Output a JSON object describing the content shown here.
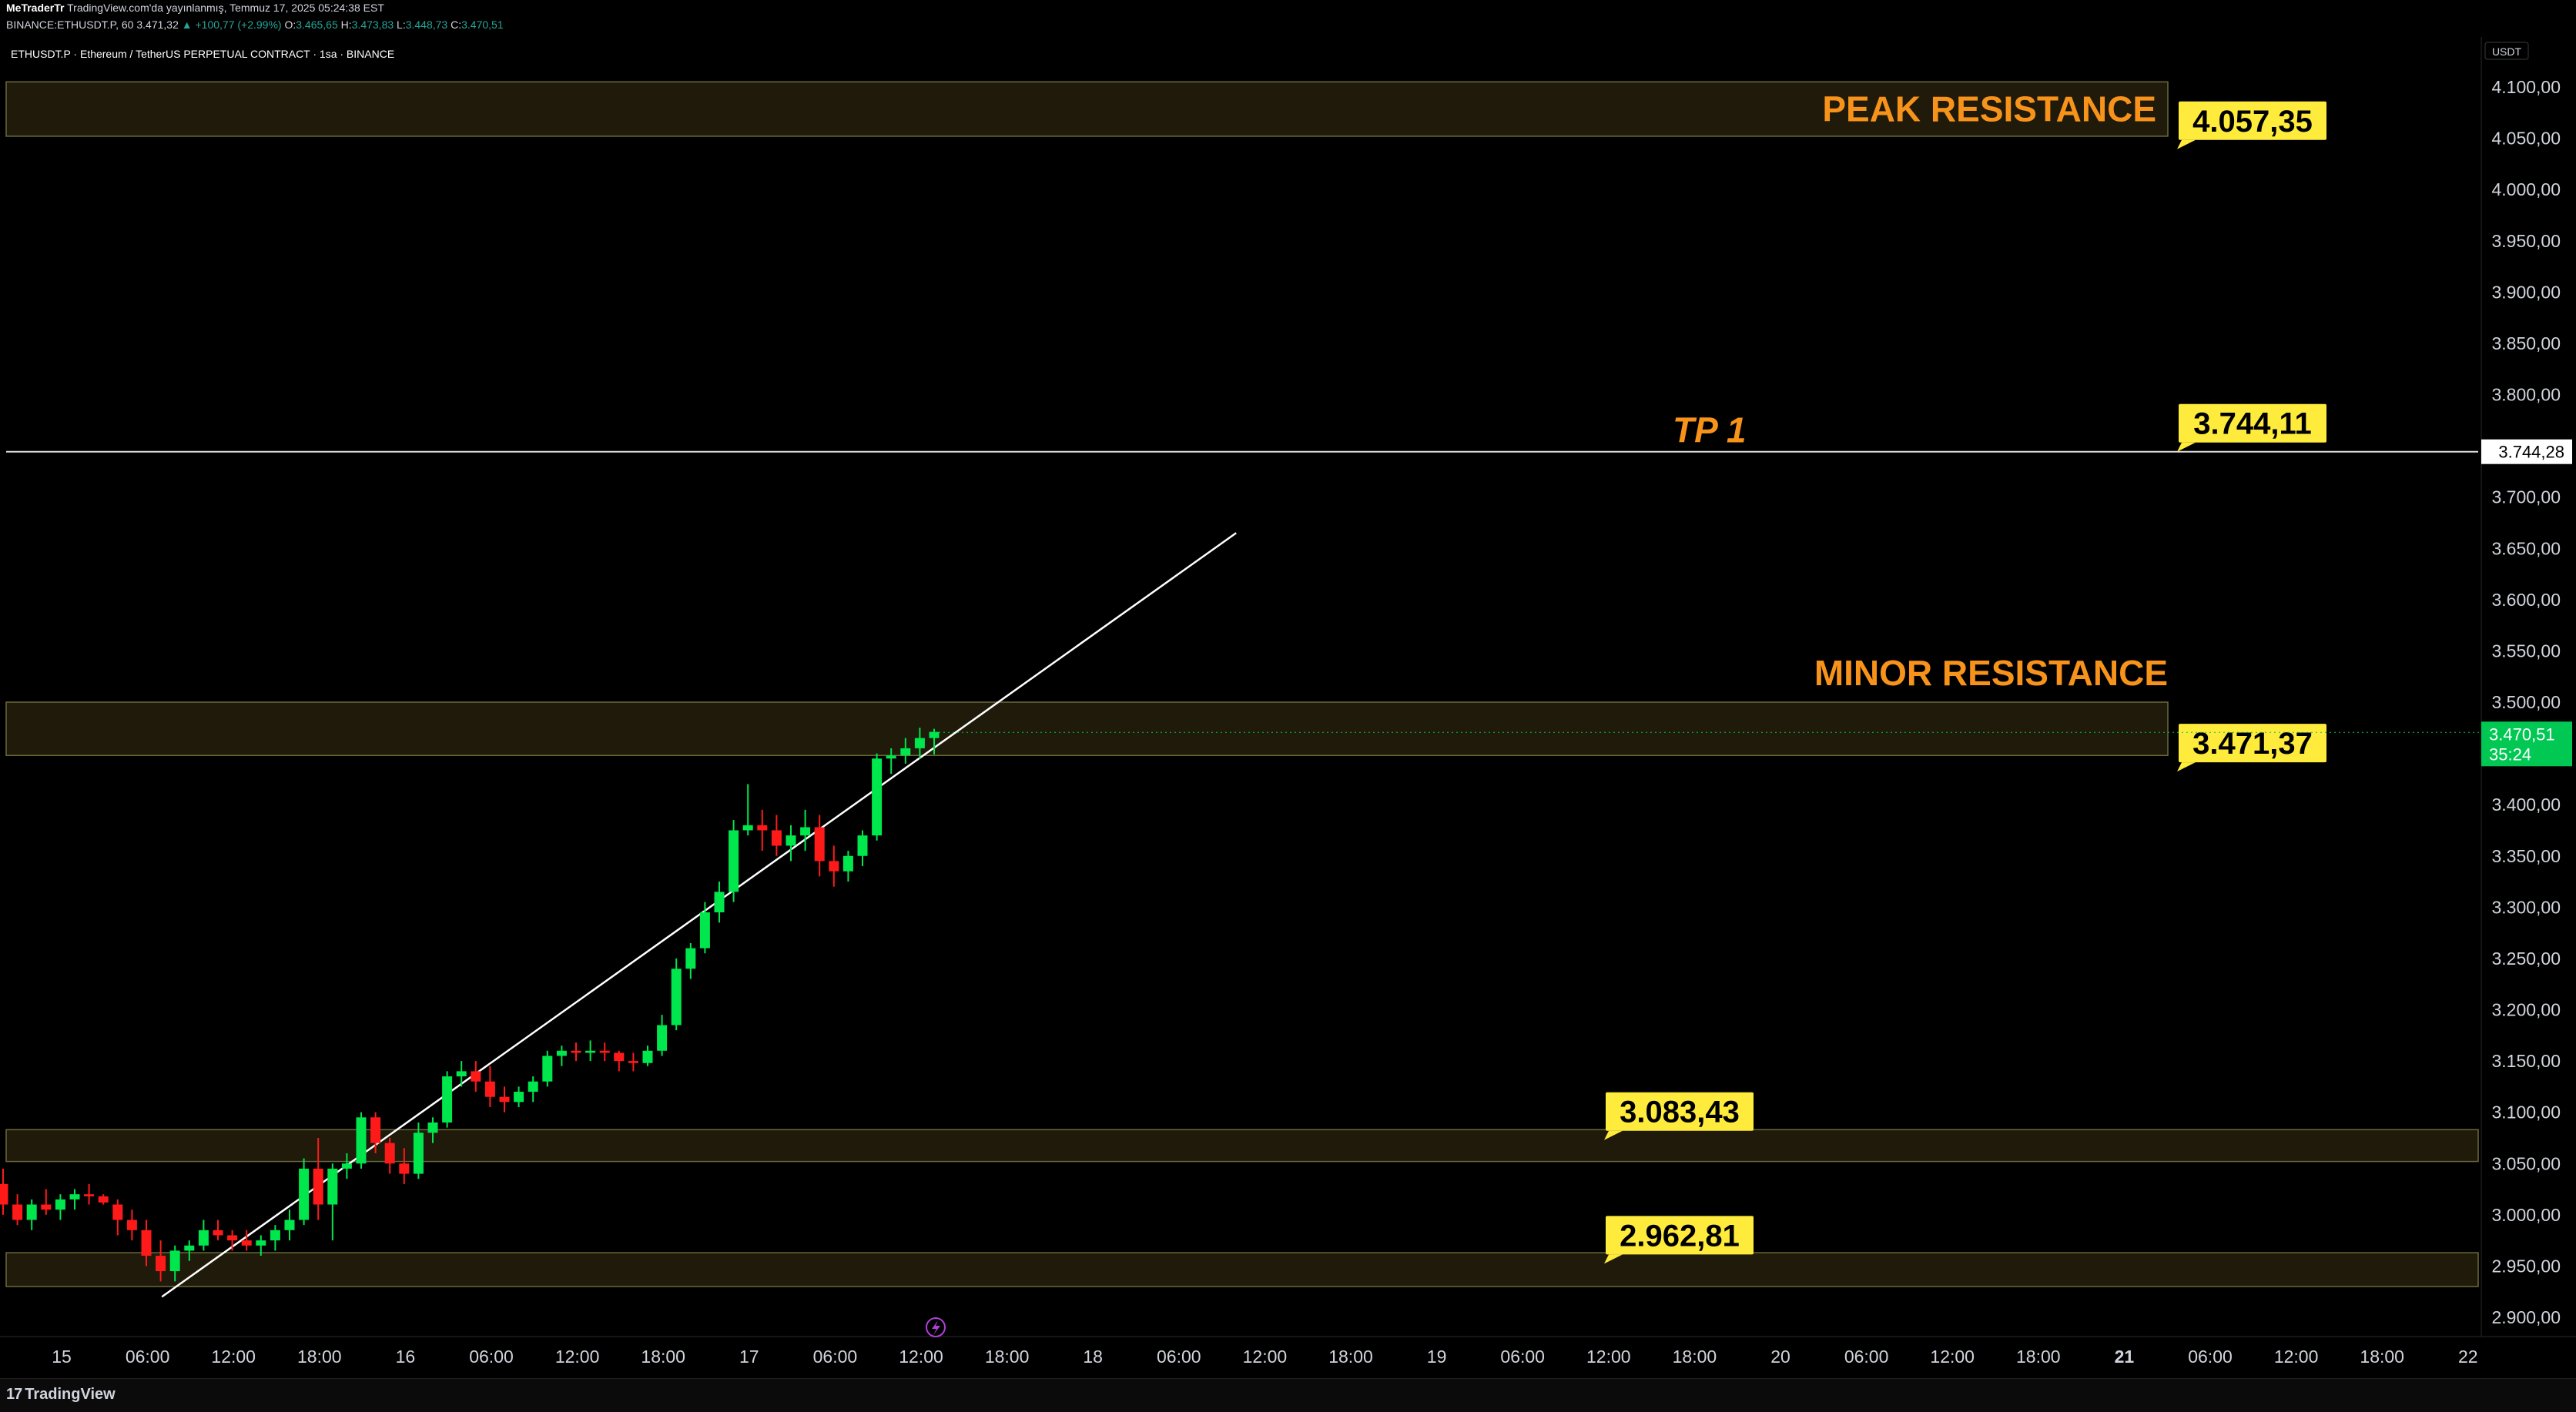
{
  "header": {
    "publisher": "MeTraderTr",
    "published_text": "TradingView.com'da yayınlanmış, Temmuz 17, 2025 05:24:38 EST",
    "symbol_line": "BINANCE:ETHUSDT.P, 60",
    "last": "3.471,32",
    "change": "▲ +100,77 (+2.99%)",
    "o_label": "O:",
    "o_value": "3.465,65",
    "h_label": "H:",
    "h_value": "3.473,83",
    "l_label": "L:",
    "l_value": "3.448,73",
    "c_label": "C:",
    "c_value": "3.470,51"
  },
  "symbol_title": "ETHUSDT.P · Ethereum / TetherUS PERPETUAL CONTRACT · 1sa · BINANCE",
  "footer": {
    "brand": "TradingView",
    "brand_mark": "17"
  },
  "colors": {
    "bullish": "#00e64d",
    "bearish": "#ff1a1a",
    "zone_fill": "#1f1a0a",
    "zone_border": "#6b6a3a",
    "callout_bg": "#ffeb3b",
    "label_orange": "#f7931a",
    "price_tag": "#00c853"
  },
  "chart_data": {
    "type": "candlestick",
    "unit": "USDT",
    "ylim": [
      2880,
      4120
    ],
    "y_ticks": [
      {
        "value": 4100,
        "label": "4.100,00"
      },
      {
        "value": 4050,
        "label": "4.050,00"
      },
      {
        "value": 4000,
        "label": "4.000,00"
      },
      {
        "value": 3950,
        "label": "3.950,00"
      },
      {
        "value": 3900,
        "label": "3.900,00"
      },
      {
        "value": 3850,
        "label": "3.850,00"
      },
      {
        "value": 3800,
        "label": "3.800,00"
      },
      {
        "value": 3700,
        "label": "3.700,00"
      },
      {
        "value": 3650,
        "label": "3.650,00"
      },
      {
        "value": 3600,
        "label": "3.600,00"
      },
      {
        "value": 3550,
        "label": "3.550,00"
      },
      {
        "value": 3500,
        "label": "3.500,00"
      },
      {
        "value": 3400,
        "label": "3.400,00"
      },
      {
        "value": 3350,
        "label": "3.350,00"
      },
      {
        "value": 3300,
        "label": "3.300,00"
      },
      {
        "value": 3250,
        "label": "3.250,00"
      },
      {
        "value": 3200,
        "label": "3.200,00"
      },
      {
        "value": 3150,
        "label": "3.150,00"
      },
      {
        "value": 3100,
        "label": "3.100,00"
      },
      {
        "value": 3050,
        "label": "3.050,00"
      },
      {
        "value": 3000,
        "label": "3.000,00"
      },
      {
        "value": 2950,
        "label": "2.950,00"
      },
      {
        "value": 2900,
        "label": "2.900,00"
      }
    ],
    "x_range_hours": [
      -2,
      172
    ],
    "x_ticks": [
      {
        "h": 0,
        "label": "15",
        "bold": false
      },
      {
        "h": 6,
        "label": "06:00",
        "bold": false
      },
      {
        "h": 12,
        "label": "12:00",
        "bold": false
      },
      {
        "h": 18,
        "label": "18:00",
        "bold": false
      },
      {
        "h": 24,
        "label": "16",
        "bold": false
      },
      {
        "h": 30,
        "label": "06:00",
        "bold": false
      },
      {
        "h": 36,
        "label": "12:00",
        "bold": false
      },
      {
        "h": 42,
        "label": "18:00",
        "bold": false
      },
      {
        "h": 48,
        "label": "17",
        "bold": false
      },
      {
        "h": 54,
        "label": "06:00",
        "bold": false
      },
      {
        "h": 60,
        "label": "12:00",
        "bold": false
      },
      {
        "h": 66,
        "label": "18:00",
        "bold": false
      },
      {
        "h": 72,
        "label": "18",
        "bold": false
      },
      {
        "h": 78,
        "label": "06:00",
        "bold": false
      },
      {
        "h": 84,
        "label": "12:00",
        "bold": false
      },
      {
        "h": 90,
        "label": "18:00",
        "bold": false
      },
      {
        "h": 96,
        "label": "19",
        "bold": false
      },
      {
        "h": 102,
        "label": "06:00",
        "bold": false
      },
      {
        "h": 108,
        "label": "12:00",
        "bold": false
      },
      {
        "h": 114,
        "label": "18:00",
        "bold": false
      },
      {
        "h": 120,
        "label": "20",
        "bold": false
      },
      {
        "h": 126,
        "label": "06:00",
        "bold": false
      },
      {
        "h": 132,
        "label": "12:00",
        "bold": false
      },
      {
        "h": 138,
        "label": "18:00",
        "bold": false
      },
      {
        "h": 144,
        "label": "21",
        "bold": true
      },
      {
        "h": 150,
        "label": "06:00",
        "bold": false
      },
      {
        "h": 156,
        "label": "12:00",
        "bold": false
      },
      {
        "h": 162,
        "label": "18:00",
        "bold": false
      },
      {
        "h": 168,
        "label": "22",
        "bold": false
      }
    ],
    "candles_ohlc": [
      [
        3030,
        3045,
        3000,
        3010
      ],
      [
        3010,
        3020,
        2990,
        2995
      ],
      [
        2995,
        3015,
        2985,
        3010
      ],
      [
        3010,
        3025,
        3000,
        3005
      ],
      [
        3005,
        3020,
        2995,
        3015
      ],
      [
        3015,
        3025,
        3005,
        3020
      ],
      [
        3020,
        3030,
        3010,
        3018
      ],
      [
        3018,
        3020,
        3010,
        3012
      ],
      [
        3010,
        3015,
        2980,
        2995
      ],
      [
        2995,
        3005,
        2975,
        2985
      ],
      [
        2985,
        2995,
        2950,
        2960
      ],
      [
        2960,
        2975,
        2935,
        2945
      ],
      [
        2945,
        2970,
        2935,
        2965
      ],
      [
        2965,
        2975,
        2955,
        2970
      ],
      [
        2970,
        2995,
        2965,
        2985
      ],
      [
        2985,
        2995,
        2975,
        2980
      ],
      [
        2980,
        2985,
        2965,
        2975
      ],
      [
        2975,
        2985,
        2965,
        2970
      ],
      [
        2970,
        2980,
        2960,
        2975
      ],
      [
        2975,
        2990,
        2965,
        2985
      ],
      [
        2985,
        3005,
        2975,
        2995
      ],
      [
        2995,
        3055,
        2990,
        3045
      ],
      [
        3045,
        3075,
        2995,
        3010
      ],
      [
        3010,
        3050,
        2975,
        3045
      ],
      [
        3045,
        3060,
        3035,
        3050
      ],
      [
        3050,
        3100,
        3045,
        3095
      ],
      [
        3095,
        3100,
        3060,
        3070
      ],
      [
        3070,
        3075,
        3040,
        3050
      ],
      [
        3050,
        3065,
        3030,
        3040
      ],
      [
        3040,
        3090,
        3035,
        3080
      ],
      [
        3080,
        3095,
        3070,
        3090
      ],
      [
        3090,
        3140,
        3085,
        3135
      ],
      [
        3135,
        3150,
        3125,
        3140
      ],
      [
        3140,
        3150,
        3120,
        3130
      ],
      [
        3130,
        3145,
        3105,
        3115
      ],
      [
        3115,
        3125,
        3100,
        3110
      ],
      [
        3110,
        3125,
        3105,
        3120
      ],
      [
        3120,
        3135,
        3110,
        3130
      ],
      [
        3130,
        3160,
        3125,
        3155
      ],
      [
        3155,
        3165,
        3145,
        3160
      ],
      [
        3160,
        3168,
        3150,
        3158
      ],
      [
        3158,
        3170,
        3150,
        3160
      ],
      [
        3160,
        3168,
        3150,
        3158
      ],
      [
        3158,
        3160,
        3140,
        3150
      ],
      [
        3150,
        3158,
        3140,
        3148
      ],
      [
        3148,
        3165,
        3145,
        3160
      ],
      [
        3160,
        3195,
        3155,
        3185
      ],
      [
        3185,
        3250,
        3180,
        3240
      ],
      [
        3240,
        3265,
        3230,
        3260
      ],
      [
        3260,
        3305,
        3255,
        3295
      ],
      [
        3295,
        3325,
        3285,
        3315
      ],
      [
        3315,
        3385,
        3305,
        3375
      ],
      [
        3375,
        3420,
        3370,
        3380
      ],
      [
        3380,
        3395,
        3355,
        3375
      ],
      [
        3375,
        3390,
        3350,
        3360
      ],
      [
        3360,
        3380,
        3345,
        3370
      ],
      [
        3370,
        3395,
        3355,
        3378
      ],
      [
        3378,
        3390,
        3330,
        3345
      ],
      [
        3345,
        3360,
        3320,
        3335
      ],
      [
        3335,
        3355,
        3325,
        3350
      ],
      [
        3350,
        3375,
        3340,
        3370
      ],
      [
        3370,
        3450,
        3365,
        3445
      ],
      [
        3445,
        3455,
        3430,
        3448
      ],
      [
        3448,
        3465,
        3440,
        3455
      ],
      [
        3455,
        3475,
        3445,
        3465
      ],
      [
        3465,
        3474,
        3449,
        3471
      ]
    ],
    "zones": [
      {
        "top": 4105,
        "bottom": 4052,
        "label": "PEAK RESISTANCE",
        "callout": "4.057,35",
        "callout_value": 4057.35
      },
      {
        "top": 3500,
        "bottom": 3448,
        "label": "MINOR RESISTANCE",
        "callout": "3.471,37",
        "callout_value": 3471.37
      },
      {
        "top": 3083,
        "bottom": 3052,
        "label": "",
        "callout": "3.083,43",
        "callout_value": 3083.43
      },
      {
        "top": 2963,
        "bottom": 2930,
        "label": "",
        "callout": "2.962,81",
        "callout_value": 2962.81
      }
    ],
    "tp_line": {
      "value": 3744.28,
      "label": "TP 1",
      "callout": "3.744,11",
      "axis_label": "3.744,28"
    },
    "trendline": [
      {
        "h": 7,
        "v": 2920
      },
      {
        "h": 82,
        "v": 3665
      }
    ],
    "current_price": {
      "value": 3470.51,
      "label": "3.470,51",
      "countdown": "35:24"
    }
  }
}
